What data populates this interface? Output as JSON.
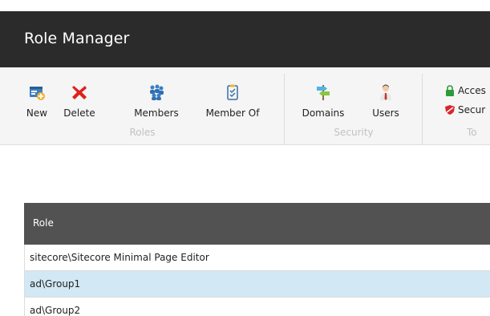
{
  "app": {
    "title": "Role Manager"
  },
  "ribbon": {
    "groups": [
      {
        "label": "Roles",
        "buttons": [
          {
            "label": "New",
            "icon": "new-role-icon"
          },
          {
            "label": "Delete",
            "icon": "delete-x-icon"
          },
          {
            "label": "Members",
            "icon": "members-icon"
          },
          {
            "label": "Member Of",
            "icon": "member-of-clipboard-icon"
          }
        ]
      },
      {
        "label": "Security",
        "buttons": [
          {
            "label": "Domains",
            "icon": "domains-signpost-icon"
          },
          {
            "label": "Users",
            "icon": "user-icon"
          }
        ]
      },
      {
        "label": "To",
        "small_items": [
          {
            "label": "Acces",
            "icon": "lock-icon"
          },
          {
            "label": "Secur",
            "icon": "shield-icon"
          }
        ]
      }
    ]
  },
  "table": {
    "columns": [
      "Role"
    ],
    "rows": [
      {
        "role": "sitecore\\Sitecore Minimal Page Editor",
        "selected": false
      },
      {
        "role": "ad\\Group1",
        "selected": true
      },
      {
        "role": "ad\\Group2",
        "selected": false
      }
    ]
  },
  "colors": {
    "titlebar_bg": "#2b2b2b",
    "ribbon_bg": "#f5f5f5",
    "table_header_bg": "#525252",
    "selected_row_bg": "#d2e8f5",
    "delete_red": "#e0201b"
  }
}
